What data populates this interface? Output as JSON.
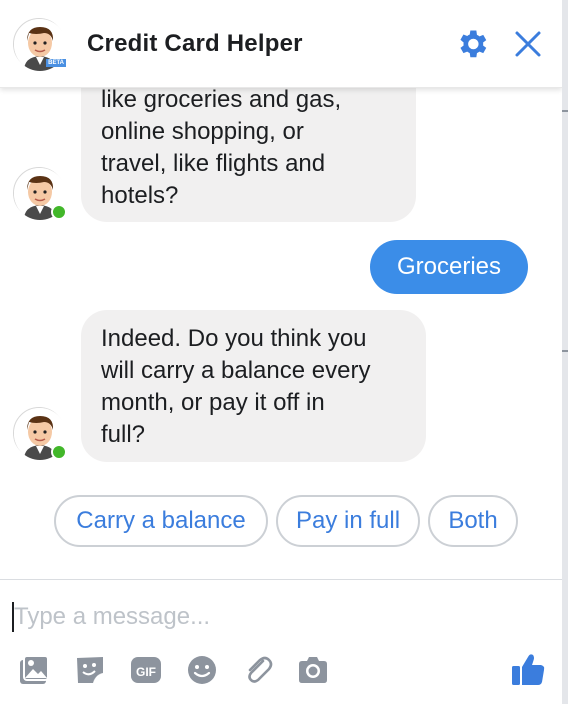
{
  "header": {
    "title": "Credit Card Helper",
    "settings_icon": "gear-icon",
    "close_icon": "close-icon",
    "avatar_badge": "BETA",
    "accent_color": "#3b7ddd"
  },
  "messages": [
    {
      "sender": "bot",
      "lines": [
        "like groceries and gas,",
        "online shopping, or",
        "travel, like flights and",
        "hotels?"
      ]
    },
    {
      "sender": "user",
      "text": "Groceries",
      "color": "#3b8de8"
    },
    {
      "sender": "bot",
      "lines": [
        "Indeed. Do you think you",
        "will carry a balance every",
        "month, or pay it off in",
        "full?"
      ]
    }
  ],
  "quick_replies": [
    "Carry a balance",
    "Pay in full",
    "Both"
  ],
  "composer": {
    "placeholder": "Type a message...",
    "value": "",
    "tools": [
      "photo-icon",
      "sticker-icon",
      "gif-icon",
      "emoji-icon",
      "attachment-icon",
      "camera-icon"
    ],
    "gif_label": "GIF",
    "send_icon": "thumbs-up-icon"
  }
}
